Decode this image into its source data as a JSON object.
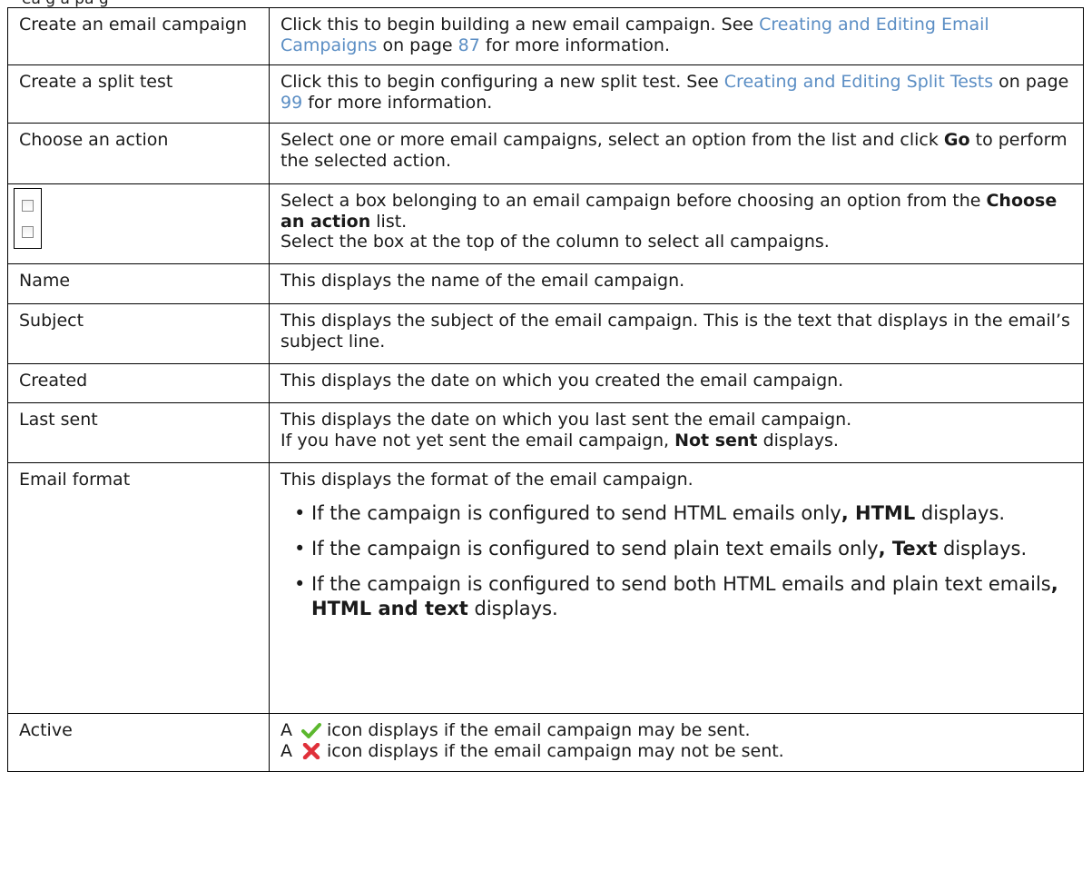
{
  "top_clip": "ea                 g a          pa g",
  "rows": [
    {
      "term": "Create an email campaign",
      "desc": {
        "pre": "Click this to begin building a new email campaign. See ",
        "link": "Creating and Editing Email Campaigns",
        "mid": " on page ",
        "page": "87",
        "post": " for more information."
      }
    },
    {
      "term": "Create a split test",
      "desc": {
        "pre": "Click this to begin configuring a new split test. See ",
        "link": "Creating and Editing Split Tests",
        "mid": " on page ",
        "page": "99",
        "post": " for more information."
      }
    },
    {
      "term": "Choose an action",
      "desc": {
        "pre": "Select one or more email campaigns, select an option from the list and click ",
        "bold": "Go",
        "post": " to perform the selected action."
      }
    },
    {
      "term": "",
      "desc": {
        "line1_pre": "Select a box belonging to an email campaign before choosing an option from the ",
        "line1_bold": "Choose an action",
        "line1_post": " list.",
        "line2": "Select the box at the top of the column to select all campaigns."
      }
    },
    {
      "term": "Name",
      "desc": {
        "text": "This displays the name of the email campaign."
      }
    },
    {
      "term": "Subject",
      "desc": {
        "text": "This displays the subject of the email campaign. This is the text that displays in the email’s subject line."
      }
    },
    {
      "term": "Created",
      "desc": {
        "text": "This displays the date on which you created the email campaign."
      }
    },
    {
      "term": "Last sent",
      "desc": {
        "line1": "This displays the date on which you last sent the email campaign.",
        "line2_pre": "If you have not yet sent the email campaign, ",
        "line2_bold": "Not sent",
        "line2_post": " displays."
      }
    },
    {
      "term": "Email format",
      "desc": {
        "intro": "This displays the format of the email campaign.",
        "bullets": [
          {
            "pre": "If the campaign is configured to send HTML emails only",
            "bold": ", HTML",
            "post": " displays."
          },
          {
            "pre": "If the campaign is configured to send plain text emails only",
            "bold": ", Text",
            "post": " displays."
          },
          {
            "pre": "If the campaign is configured to send both HTML emails and plain text emails",
            "bold": ", HTML and text",
            "post": " displays."
          }
        ]
      }
    },
    {
      "term": "Active",
      "desc": {
        "line1_pre": "A",
        "line1_post": "icon displays if the email campaign may be sent.",
        "line2_pre": "A",
        "line2_post": "icon displays if the email campaign may not be sent."
      }
    }
  ],
  "bullet_char": "•",
  "colors": {
    "link": "#5b8ec4",
    "check": "#5cb82e",
    "cross": "#e0303a"
  },
  "icons": [
    "checkbox-icon",
    "checkmark-icon",
    "cross-icon"
  ]
}
